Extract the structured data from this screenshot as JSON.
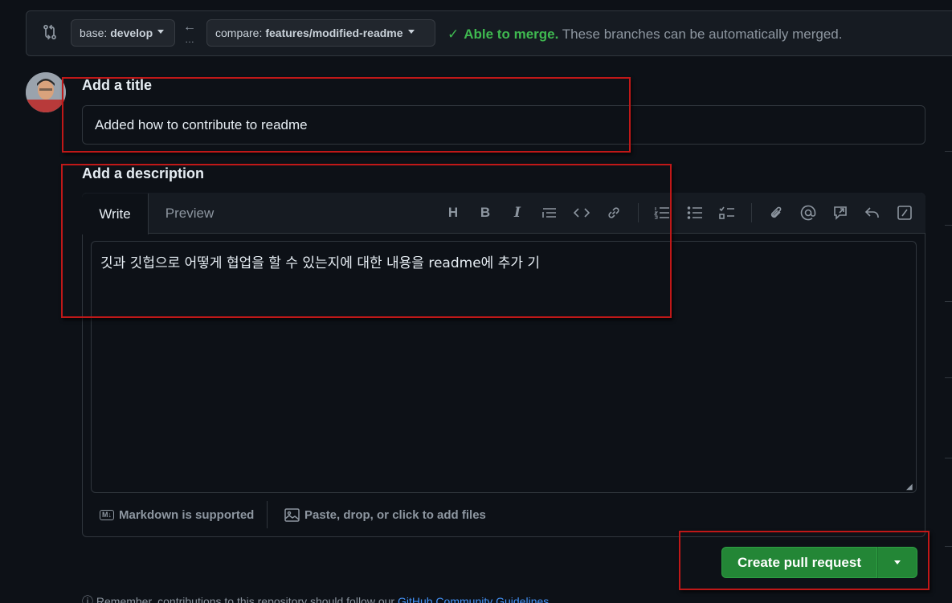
{
  "compare": {
    "base_prefix": "base:",
    "base_branch": "develop",
    "compare_prefix": "compare:",
    "compare_branch": "features/modified-readme",
    "merge_ok": "Able to merge.",
    "merge_msg": " These branches can be automatically merged."
  },
  "title_section": {
    "label": "Add a title",
    "value": "Added how to contribute to readme"
  },
  "description_section": {
    "label": "Add a description",
    "tabs": [
      "Write",
      "Preview"
    ],
    "value": "깃과 깃헙으로 어떻게 협업을 할 수 있는지에 대한 내용을 readme에 추가 기",
    "markdown_note": "Markdown is supported",
    "attach_note": "Paste, drop, or click to add files"
  },
  "toolbar_icons": [
    "heading-icon",
    "bold-icon",
    "italic-icon",
    "quote-icon",
    "code-icon",
    "link-icon",
    "numbered-list-icon",
    "unordered-list-icon",
    "task-list-icon",
    "attach-icon",
    "mention-icon",
    "reference-icon",
    "reply-icon",
    "slash-commands-icon"
  ],
  "actions": {
    "create_pr": "Create pull request"
  },
  "footer": {
    "note": "Remember, contributions to this repository should follow our ",
    "link": "GitHub Community Guidelines"
  },
  "colors": {
    "accent_green": "#238636",
    "merge_green": "#3fb950",
    "highlight_red": "#c01818",
    "link_blue": "#4493f8"
  }
}
